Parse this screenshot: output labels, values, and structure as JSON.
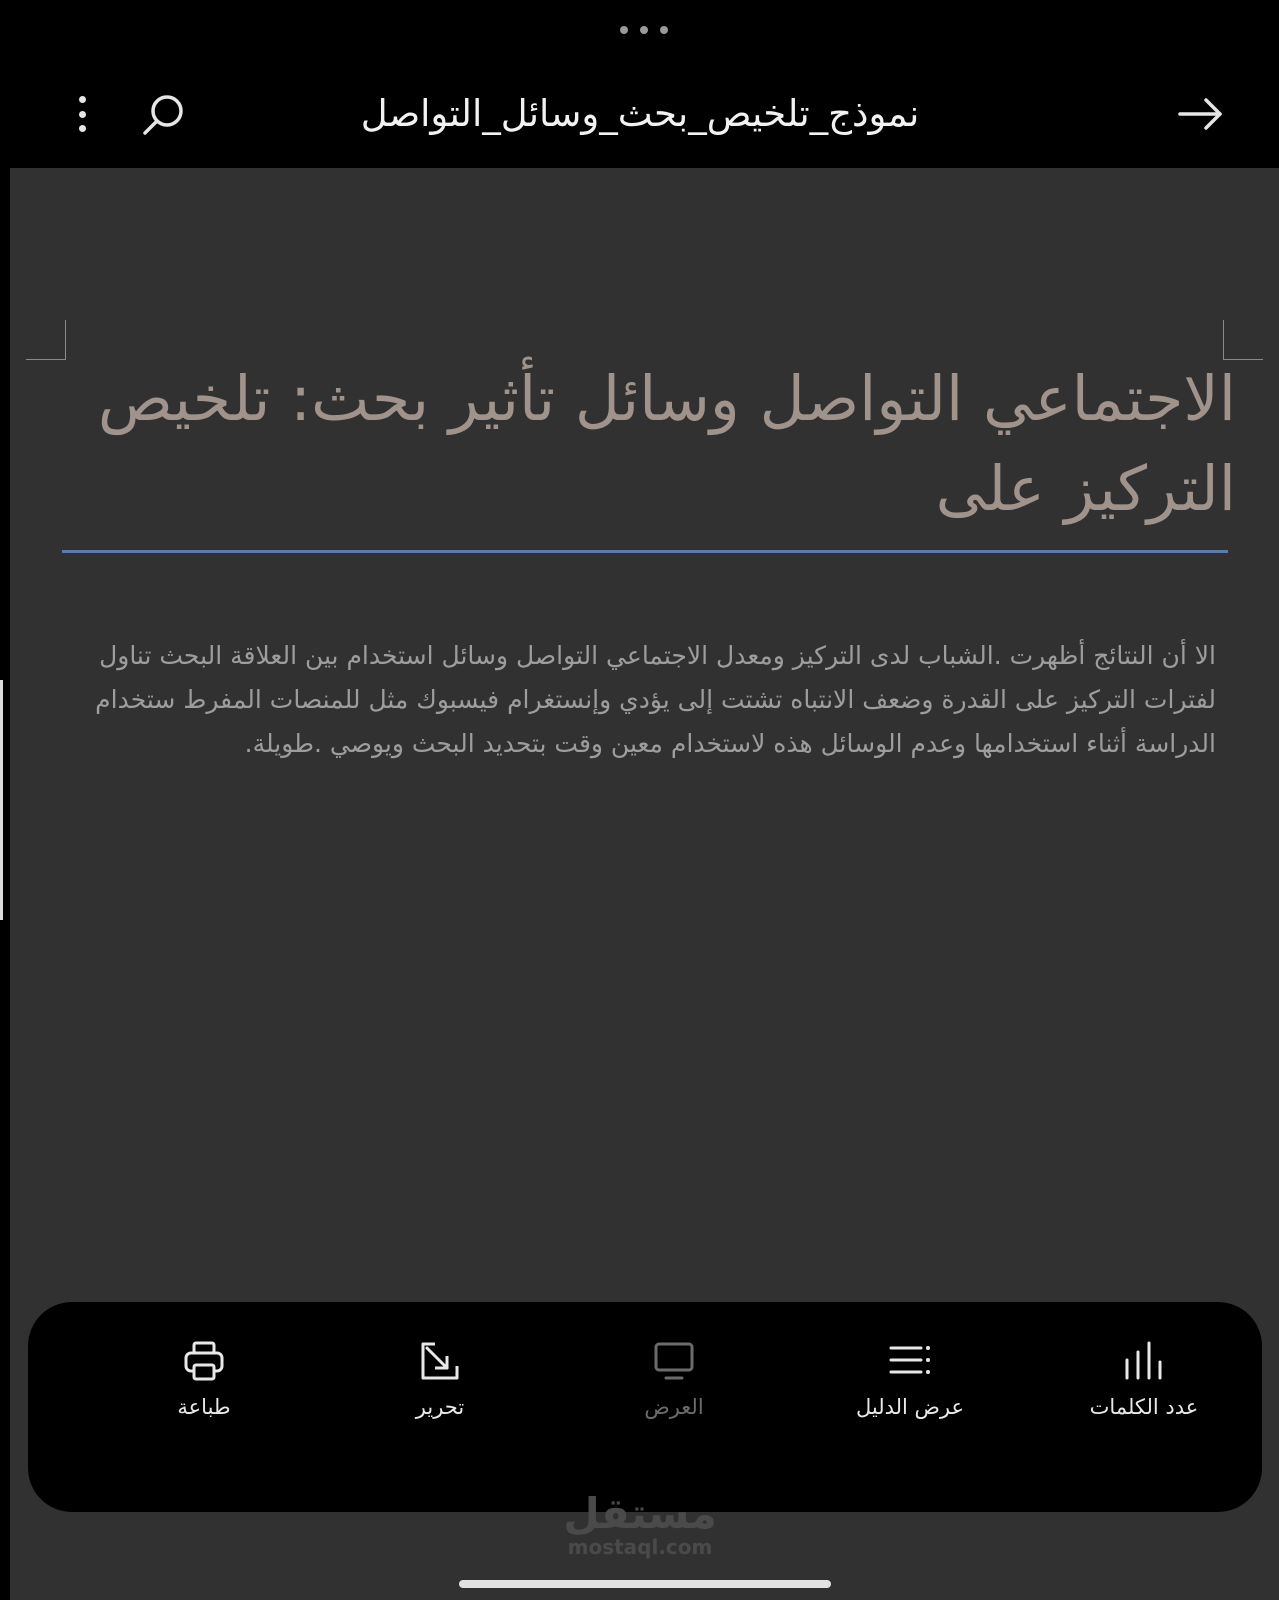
{
  "header": {
    "title": "نموذج_تلخيص_بحث_وسائل_التواصل",
    "icons": {
      "menu": "more-vertical-icon",
      "search": "search-icon",
      "back": "arrow-right-icon"
    }
  },
  "document": {
    "heading": "الاجتماعي التواصل وسائل تأثير بحث: تلخيص التركيز على",
    "body": "الا أن النتائج أظهرت .الشباب لدى التركيز ومعدل الاجتماعي التواصل وسائل استخدام بين العلاقة البحث تناول لفترات التركيز على القدرة وضعف الانتباه تشتت إلى يؤدي وإنستغرام فيسبوك مثل للمنصات المفرط ستخدام الدراسة أثناء استخدامها وعدم الوسائل هذه لاستخدام معين وقت بتحديد البحث ويوصي .طويلة."
  },
  "toolbar": {
    "items": [
      {
        "label": "طباعة",
        "icon": "printer-icon",
        "enabled": true
      },
      {
        "label": "تحرير",
        "icon": "edit-icon",
        "enabled": true
      },
      {
        "label": "العرض",
        "icon": "monitor-icon",
        "enabled": false
      },
      {
        "label": "عرض الدليل",
        "icon": "outline-list-icon",
        "enabled": true
      },
      {
        "label": "عدد الكلمات",
        "icon": "bar-chart-icon",
        "enabled": true
      }
    ]
  },
  "watermark": {
    "arabic": "مستقل",
    "latin": "mostaql.com"
  },
  "colors": {
    "background": "#000000",
    "canvas": "#313131",
    "heading": "#9f938c",
    "rule": "#5a7bac",
    "body_text": "#9d9d9d",
    "disabled": "#6b6b6b"
  }
}
